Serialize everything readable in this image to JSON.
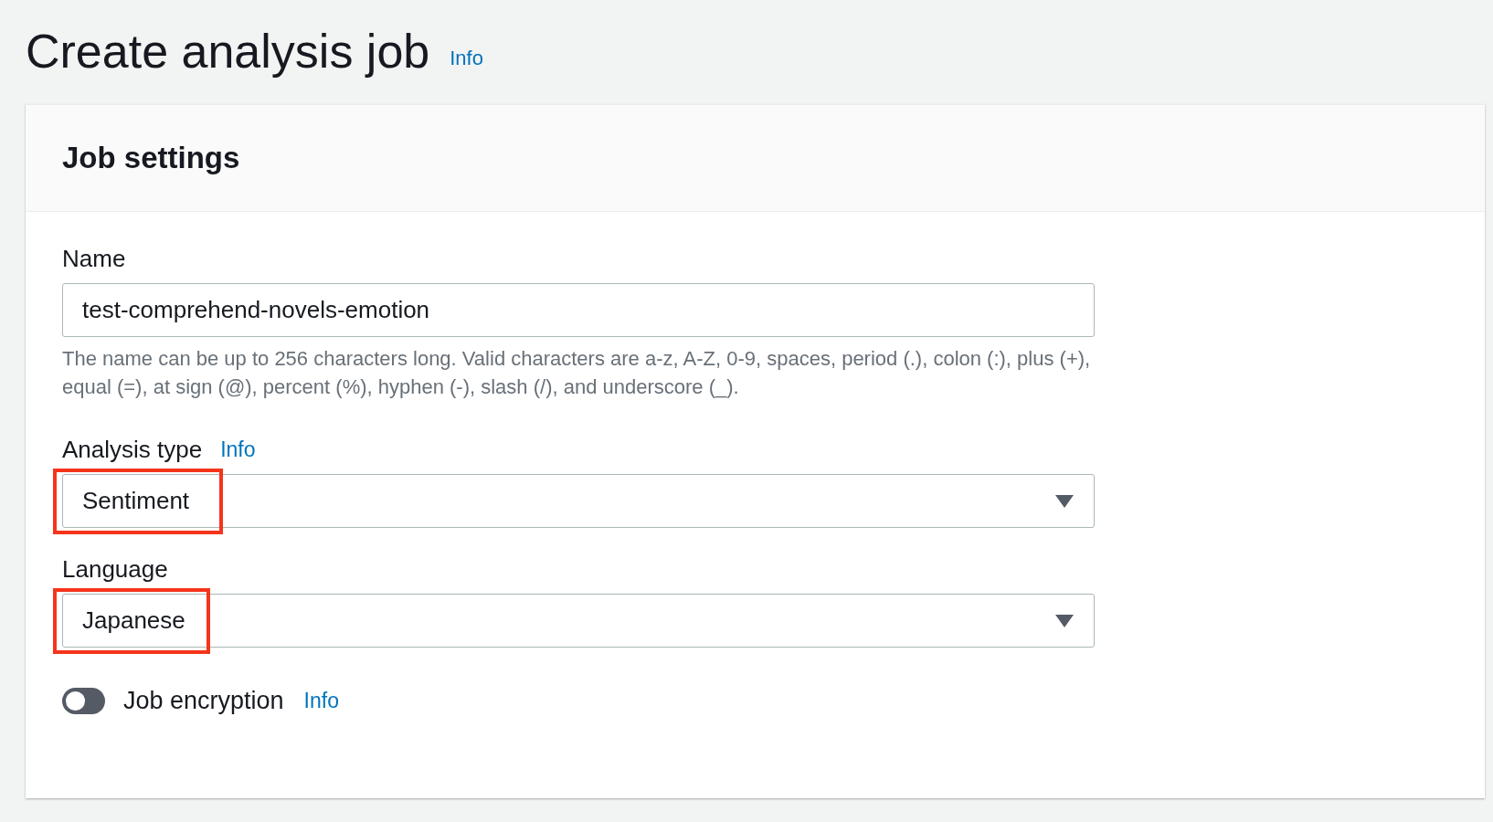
{
  "page": {
    "title": "Create analysis job",
    "info": "Info"
  },
  "card": {
    "title": "Job settings",
    "name": {
      "label": "Name",
      "value": "test-comprehend-novels-emotion",
      "help": "The name can be up to 256 characters long. Valid characters are a-z, A-Z, 0-9, spaces, period (.), colon (:), plus (+), equal (=), at sign (@), percent (%), hyphen (-), slash (/), and underscore (_)."
    },
    "selects": [
      {
        "label": "Analysis type",
        "info": "Info",
        "value": "Sentiment",
        "highlighted": true
      },
      {
        "label": "Language",
        "value": "Japanese",
        "highlighted": true
      }
    ],
    "encryption": {
      "label": "Job encryption",
      "info": "Info",
      "on": false
    }
  }
}
